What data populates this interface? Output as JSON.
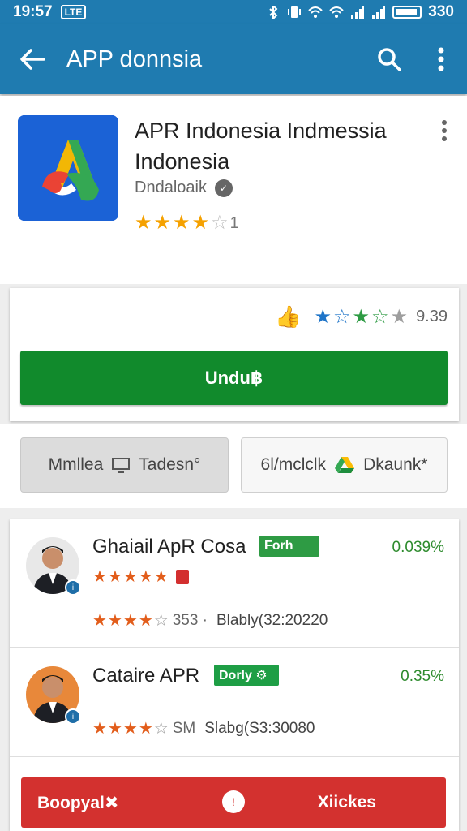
{
  "status_bar": {
    "time": "19:57",
    "badge": "LTE",
    "battery_text": "330"
  },
  "app_bar": {
    "title": "APP donnsia"
  },
  "app": {
    "title": "APR Indonesia Indmessia Indonesia",
    "developer": "Dndaloaik",
    "rating_count": "1",
    "rating_stars": 3.5
  },
  "install": {
    "mini_rating_value": "9.39",
    "button_label": "Undu฿"
  },
  "secondary_buttons": {
    "left_label": "Mmllea",
    "left_label2": "Tadesn°",
    "right_label": "6l/mclclk",
    "right_label2": "Dkaunk*"
  },
  "reviews": [
    {
      "name": "Ghaiail ApR Cosa",
      "tag": "Forh",
      "percent": "0.039%",
      "stars_line": "353 ·",
      "link": "Blably(32:20220"
    },
    {
      "name": "Cataire APR",
      "tag": "Dorly ⚙",
      "percent": "0.35%",
      "stars_line": "SM",
      "link": "Slabg(S3:30080"
    }
  ],
  "bottom_bar": {
    "left_label": "Boopyal✖",
    "right_label": "Xiickes"
  },
  "colors": {
    "primary": "#1f7bb0",
    "install_green": "#118a2c",
    "star_orange": "#f5a100",
    "review_star": "#e25d1b",
    "percent_green": "#2e8b2e",
    "bottom_red": "#d3312f"
  },
  "icons": {
    "back": "arrow-back-icon",
    "search": "search-icon",
    "more": "more-vert-icon",
    "verified": "verified-icon"
  }
}
